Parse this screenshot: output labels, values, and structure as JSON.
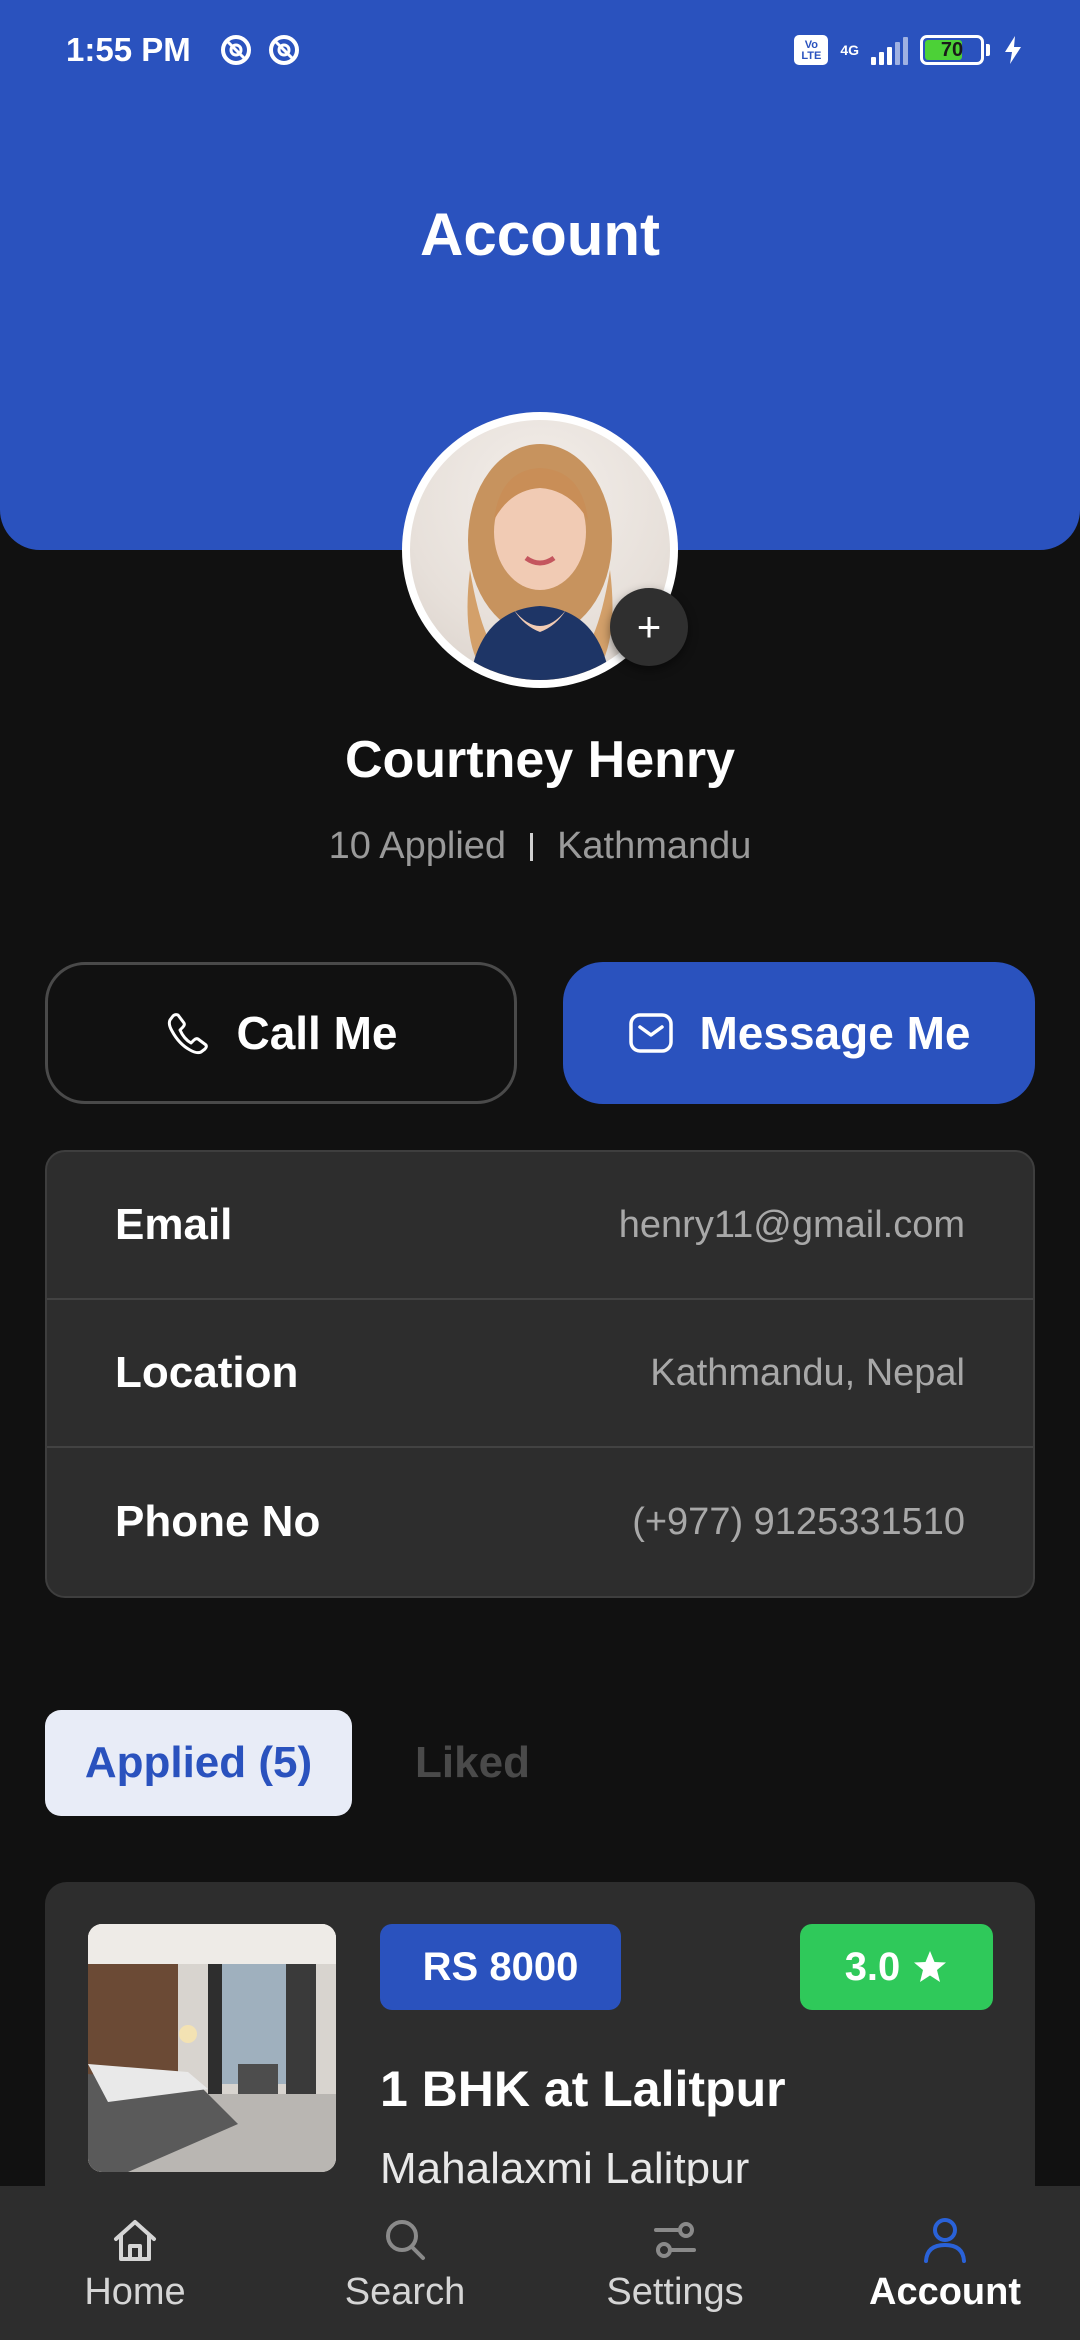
{
  "status_bar": {
    "time": "1:55 PM",
    "network": "4G",
    "battery": "70",
    "battery_level": 0.7,
    "volte_label": "Vo LTE",
    "icons": [
      "dnd-icon",
      "dnd-icon",
      "volte-icon",
      "signal-icon",
      "battery-icon",
      "charging-icon"
    ]
  },
  "header": {
    "title": "Account"
  },
  "profile": {
    "name": "Courtney Henry",
    "applied": "10 Applied",
    "city": "Kathmandu"
  },
  "actions": {
    "call_label": "Call Me",
    "message_label": "Message Me"
  },
  "info": [
    {
      "label": "Email",
      "value": "henry11@gmail.com"
    },
    {
      "label": "Location",
      "value": "Kathmandu, Nepal"
    },
    {
      "label": "Phone No",
      "value": "(+977) 9125331510"
    }
  ],
  "tabs": [
    {
      "label": "Applied (5)",
      "active": true
    },
    {
      "label": "Liked",
      "active": false
    }
  ],
  "listing": {
    "price": "RS 8000",
    "rating": "3.0",
    "title": "1 BHK at Lalitpur",
    "location": "Mahalaxmi Lalitpur"
  },
  "bottom_nav": [
    {
      "label": "Home",
      "icon": "home-icon",
      "active": false
    },
    {
      "label": "Search",
      "icon": "search-icon",
      "active": false
    },
    {
      "label": "Settings",
      "icon": "settings-icon",
      "active": false
    },
    {
      "label": "Account",
      "icon": "user-icon",
      "active": true
    }
  ],
  "colors": {
    "brand": "#2a52be",
    "background": "#111111",
    "card": "#2d2d2d",
    "rating_green": "#2fc95a"
  }
}
